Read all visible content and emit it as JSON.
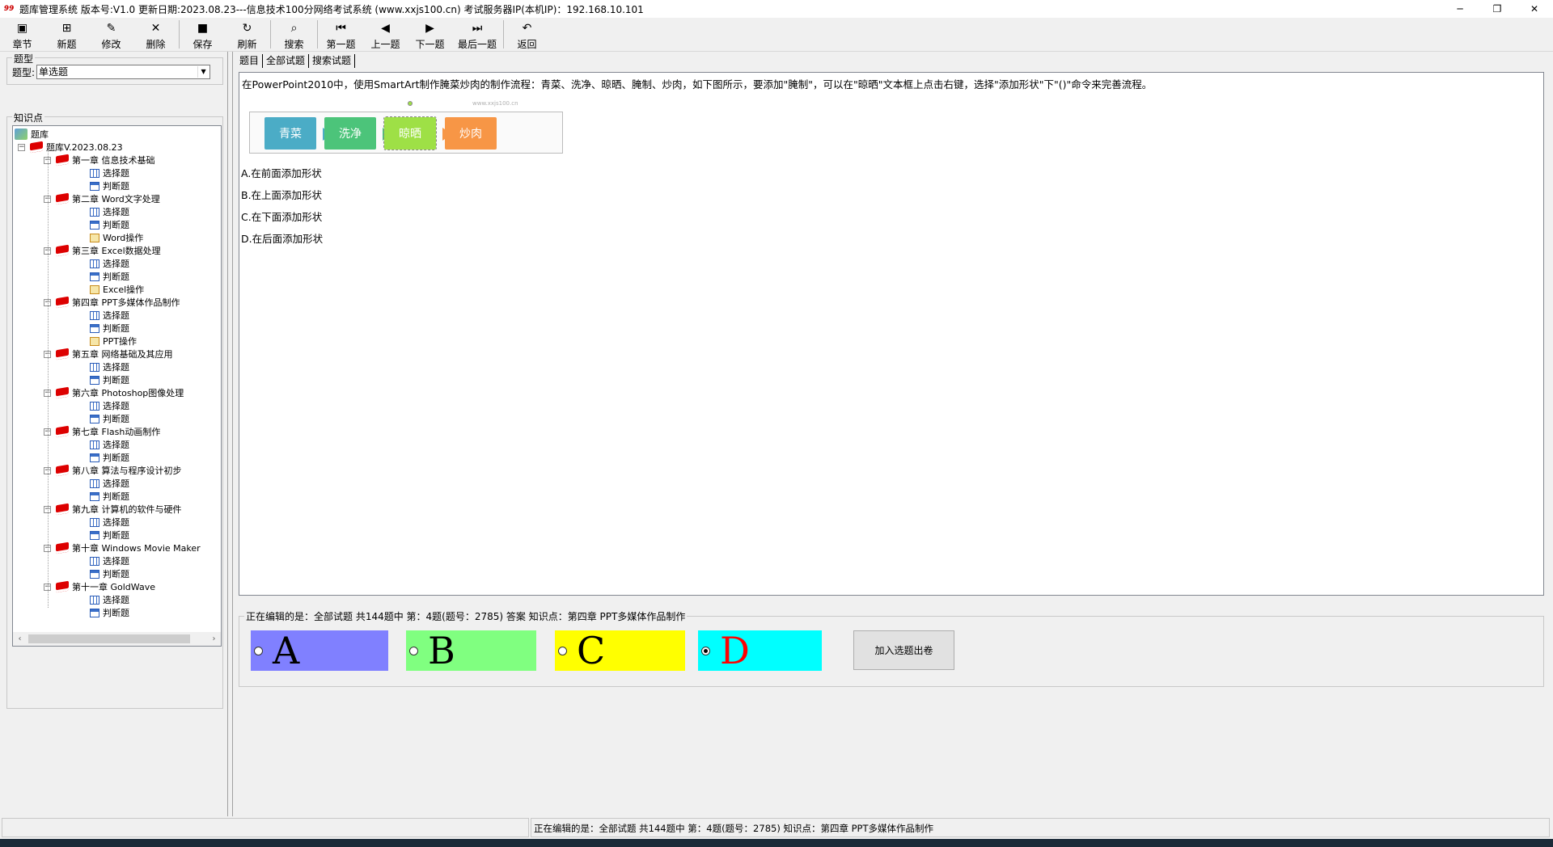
{
  "window": {
    "app_icon": "app-logo-icon",
    "title": "题库管理系统 版本号:V1.0 更新日期:2023.08.23---信息技术100分网络考试系统    (www.xxjs100.cn)     考试服务器IP(本机IP)：192.168.10.101",
    "controls": {
      "minimize": "─",
      "restore": "❐",
      "close": "✕"
    }
  },
  "toolbar": {
    "buttons": [
      {
        "label": "章节",
        "icon": "chapter-icon",
        "glyph": "▣"
      },
      {
        "label": "新题",
        "icon": "new-question-icon",
        "glyph": "⊞"
      },
      {
        "label": "修改",
        "icon": "edit-icon",
        "glyph": "✎"
      },
      {
        "label": "删除",
        "icon": "delete-icon",
        "glyph": "✕"
      },
      {
        "label": "保存",
        "icon": "save-icon",
        "glyph": "■"
      },
      {
        "label": "刷新",
        "icon": "refresh-icon",
        "glyph": "↻"
      },
      {
        "label": "搜索",
        "icon": "search-icon",
        "glyph": "⌕"
      },
      {
        "label": "第一题",
        "icon": "first-icon",
        "glyph": "⏮"
      },
      {
        "label": "上一题",
        "icon": "prev-icon",
        "glyph": "◀"
      },
      {
        "label": "下一题",
        "icon": "next-icon",
        "glyph": "▶"
      },
      {
        "label": "最后一题",
        "icon": "last-icon",
        "glyph": "⏭"
      },
      {
        "label": "返回",
        "icon": "return-icon",
        "glyph": "↶"
      }
    ]
  },
  "left": {
    "type_group_label": "题型",
    "type_label": "题型:",
    "type_value": "单选题",
    "knowledge_group_label": "知识点",
    "tree": {
      "root": "题库",
      "bank": "题库V.2023.08.23",
      "chapters": [
        {
          "name": "第一章 信息技术基础",
          "items": [
            "选择题",
            "判断题"
          ]
        },
        {
          "name": "第二章 Word文字处理",
          "items": [
            "选择题",
            "判断题",
            "Word操作"
          ]
        },
        {
          "name": "第三章 Excel数据处理",
          "items": [
            "选择题",
            "判断题",
            "Excel操作"
          ]
        },
        {
          "name": "第四章 PPT多媒体作品制作",
          "items": [
            "选择题",
            "判断题",
            "PPT操作"
          ]
        },
        {
          "name": "第五章 网络基础及其应用",
          "items": [
            "选择题",
            "判断题"
          ]
        },
        {
          "name": "第六章 Photoshop图像处理",
          "items": [
            "选择题",
            "判断题"
          ]
        },
        {
          "name": "第七章 Flash动画制作",
          "items": [
            "选择题",
            "判断题"
          ]
        },
        {
          "name": "第八章 算法与程序设计初步",
          "items": [
            "选择题",
            "判断题"
          ]
        },
        {
          "name": "第九章 计算机的软件与硬件",
          "items": [
            "选择题",
            "判断题"
          ]
        },
        {
          "name": "第十章 Windows Movie Maker",
          "items": [
            "选择题",
            "判断题"
          ]
        },
        {
          "name": "第十一章 GoldWave",
          "items": [
            "选择题",
            "判断题"
          ]
        }
      ]
    }
  },
  "tabs": [
    "题目",
    "全部试题",
    "搜索试题"
  ],
  "question": {
    "text": "在PowerPoint2010中，使用SmartArt制作腌菜炒肉的制作流程：青菜、洗净、晾晒、腌制、炒肉，如下图所示，要添加\"腌制\"，可以在\"晾晒\"文本框上点击右键，选择\"添加形状\"下\"()\"命令来完善流程。",
    "smartart": {
      "watermark": "www.xxjs100.cn",
      "steps": [
        {
          "label": "青菜",
          "color": "#4bacc6"
        },
        {
          "label": "洗净",
          "color": "#4cc47a"
        },
        {
          "label": "晾晒",
          "color": "#9ee046"
        },
        {
          "label": "炒肉",
          "color": "#f79646"
        }
      ]
    },
    "options": [
      "A.在前面添加形状",
      "B.在上面添加形状",
      "C.在下面添加形状",
      "D.在后面添加形状"
    ]
  },
  "answer": {
    "group_label": "正在编辑的是：全部试题 共144题中  第：4题(题号：2785) 答案 知识点：第四章 PPT多媒体作品制作",
    "choices": [
      {
        "letter": "A",
        "bg": "#8080ff",
        "color": "#000000",
        "checked": false
      },
      {
        "letter": "B",
        "bg": "#80ff80",
        "color": "#000000",
        "checked": false
      },
      {
        "letter": "C",
        "bg": "#ffff00",
        "color": "#000000",
        "checked": false
      },
      {
        "letter": "D",
        "bg": "#00ffff",
        "color": "#ff0000",
        "checked": true
      }
    ],
    "add_button": "加入选题出卷"
  },
  "status": {
    "text": "正在编辑的是：全部试题 共144题中  第：4题(题号：2785)  知识点：第四章 PPT多媒体作品制作"
  }
}
